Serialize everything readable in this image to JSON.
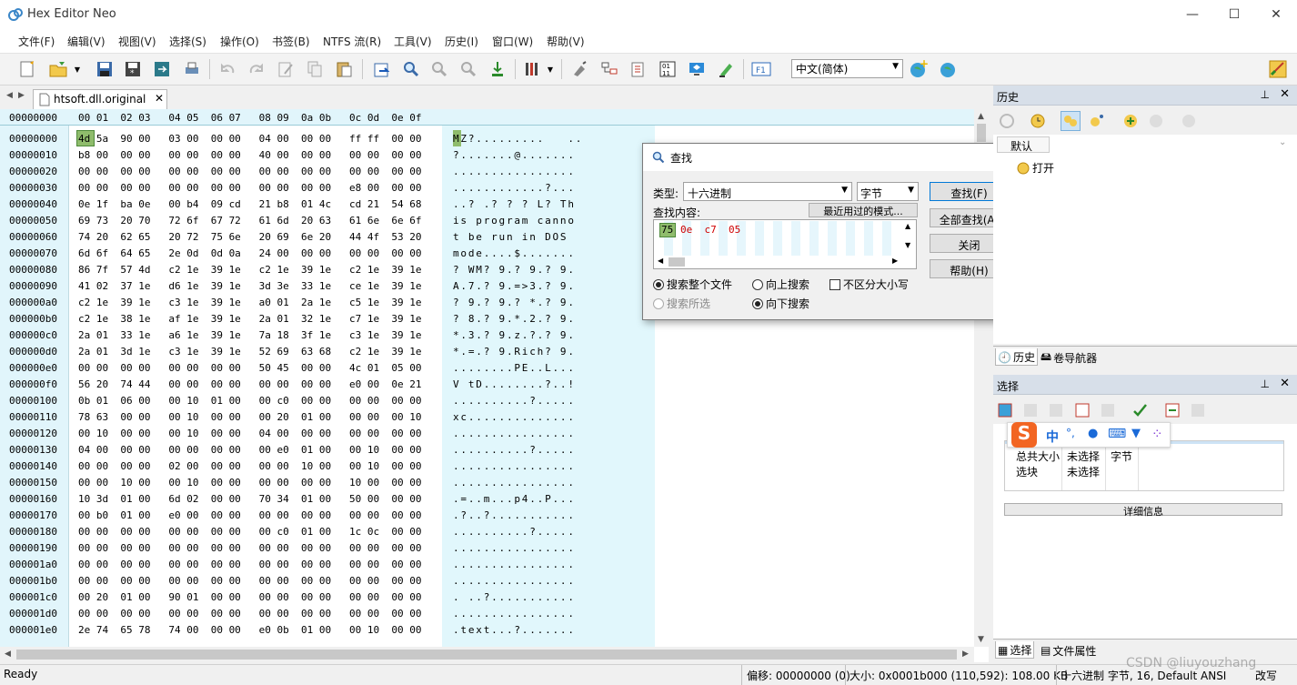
{
  "window": {
    "title": "Hex Editor Neo",
    "minimize": "—",
    "maximize": "☐",
    "close": "✕"
  },
  "menu": [
    "文件(F)",
    "编辑(V)",
    "视图(V)",
    "选择(S)",
    "操作(O)",
    "书签(B)",
    "NTFS 流(R)",
    "工具(V)",
    "历史(I)",
    "窗口(W)",
    "帮助(V)"
  ],
  "toolbar": {
    "language": "中文(简体)"
  },
  "tab": {
    "filename": "htsoft.dll.original",
    "close": "✕"
  },
  "hex_header": {
    "offset_label": "00000000",
    "columns": "00 01  02 03   04 05  06 07   08 09  0a 0b   0c 0d  0e 0f"
  },
  "hex_rows": [
    {
      "addr": "00000000",
      "bytes": "4d 5a  90 00   03 00  00 00   04 00  00 00   ff ff  00 00",
      "ascii": "MZ?.........   .."
    },
    {
      "addr": "00000010",
      "bytes": "b8 00  00 00   00 00  00 00   40 00  00 00   00 00  00 00",
      "ascii": "?.......@......."
    },
    {
      "addr": "00000020",
      "bytes": "00 00  00 00   00 00  00 00   00 00  00 00   00 00  00 00",
      "ascii": "................"
    },
    {
      "addr": "00000030",
      "bytes": "00 00  00 00   00 00  00 00   00 00  00 00   e8 00  00 00",
      "ascii": "............?..."
    },
    {
      "addr": "00000040",
      "bytes": "0e 1f  ba 0e   00 b4  09 cd   21 b8  01 4c   cd 21  54 68",
      "ascii": "..? .? ? ? L? Th"
    },
    {
      "addr": "00000050",
      "bytes": "69 73  20 70   72 6f  67 72   61 6d  20 63   61 6e  6e 6f",
      "ascii": "is program canno"
    },
    {
      "addr": "00000060",
      "bytes": "74 20  62 65   20 72  75 6e   20 69  6e 20   44 4f  53 20",
      "ascii": "t be run in DOS "
    },
    {
      "addr": "00000070",
      "bytes": "6d 6f  64 65   2e 0d  0d 0a   24 00  00 00   00 00  00 00",
      "ascii": "mode....$......."
    },
    {
      "addr": "00000080",
      "bytes": "86 7f  57 4d   c2 1e  39 1e   c2 1e  39 1e   c2 1e  39 1e",
      "ascii": "? WM? 9.? 9.? 9."
    },
    {
      "addr": "00000090",
      "bytes": "41 02  37 1e   d6 1e  39 1e   3d 3e  33 1e   ce 1e  39 1e",
      "ascii": "A.7.? 9.=>3.? 9."
    },
    {
      "addr": "000000a0",
      "bytes": "c2 1e  39 1e   c3 1e  39 1e   a0 01  2a 1e   c5 1e  39 1e",
      "ascii": "? 9.? 9.? *.? 9."
    },
    {
      "addr": "000000b0",
      "bytes": "c2 1e  38 1e   af 1e  39 1e   2a 01  32 1e   c7 1e  39 1e",
      "ascii": "? 8.? 9.*.2.? 9."
    },
    {
      "addr": "000000c0",
      "bytes": "2a 01  33 1e   a6 1e  39 1e   7a 18  3f 1e   c3 1e  39 1e",
      "ascii": "*.3.? 9.z.?.? 9."
    },
    {
      "addr": "000000d0",
      "bytes": "2a 01  3d 1e   c3 1e  39 1e   52 69  63 68   c2 1e  39 1e",
      "ascii": "*.=.? 9.Rich? 9."
    },
    {
      "addr": "000000e0",
      "bytes": "00 00  00 00   00 00  00 00   50 45  00 00   4c 01  05 00",
      "ascii": "........PE..L..."
    },
    {
      "addr": "000000f0",
      "bytes": "56 20  74 44   00 00  00 00   00 00  00 00   e0 00  0e 21",
      "ascii": "V tD........?..!"
    },
    {
      "addr": "00000100",
      "bytes": "0b 01  06 00   00 10  01 00   00 c0  00 00   00 00  00 00",
      "ascii": "..........?....."
    },
    {
      "addr": "00000110",
      "bytes": "78 63  00 00   00 10  00 00   00 20  01 00   00 00  00 10",
      "ascii": "xc.............."
    },
    {
      "addr": "00000120",
      "bytes": "00 10  00 00   00 10  00 00   04 00  00 00   00 00  00 00",
      "ascii": "................"
    },
    {
      "addr": "00000130",
      "bytes": "04 00  00 00   00 00  00 00   00 e0  01 00   00 10  00 00",
      "ascii": "..........?....."
    },
    {
      "addr": "00000140",
      "bytes": "00 00  00 00   02 00  00 00   00 00  10 00   00 10  00 00",
      "ascii": "................"
    },
    {
      "addr": "00000150",
      "bytes": "00 00  10 00   00 10  00 00   00 00  00 00   10 00  00 00",
      "ascii": "................"
    },
    {
      "addr": "00000160",
      "bytes": "10 3d  01 00   6d 02  00 00   70 34  01 00   50 00  00 00",
      "ascii": ".=..m...p4..P..."
    },
    {
      "addr": "00000170",
      "bytes": "00 b0  01 00   e0 00  00 00   00 00  00 00   00 00  00 00",
      "ascii": ".?..?..........."
    },
    {
      "addr": "00000180",
      "bytes": "00 00  00 00   00 00  00 00   00 c0  01 00   1c 0c  00 00",
      "ascii": "..........?....."
    },
    {
      "addr": "00000190",
      "bytes": "00 00  00 00   00 00  00 00   00 00  00 00   00 00  00 00",
      "ascii": "................"
    },
    {
      "addr": "000001a0",
      "bytes": "00 00  00 00   00 00  00 00   00 00  00 00   00 00  00 00",
      "ascii": "................"
    },
    {
      "addr": "000001b0",
      "bytes": "00 00  00 00   00 00  00 00   00 00  00 00   00 00  00 00",
      "ascii": "................"
    },
    {
      "addr": "000001c0",
      "bytes": "00 20  01 00   90 01  00 00   00 00  00 00   00 00  00 00",
      "ascii": ". ..?..........."
    },
    {
      "addr": "000001d0",
      "bytes": "00 00  00 00   00 00  00 00   00 00  00 00   00 00  00 00",
      "ascii": "................"
    },
    {
      "addr": "000001e0",
      "bytes": "2e 74  65 78   74 00  00 00   e0 0b  01 00   00 10  00 00",
      "ascii": ".text...?......."
    }
  ],
  "find_dialog": {
    "title": "查找",
    "close": "✕",
    "type_label": "类型:",
    "type_value": "十六进制",
    "unit_value": "字节",
    "content_label": "查找内容:",
    "recent_button": "最近用过的模式...",
    "pattern_first": "75",
    "pattern_rest": "0e  c7  05",
    "find_button": "查找(F)",
    "find_all_button": "全部查找(A)",
    "close_button": "关闭",
    "help_button": "帮助(H)",
    "radio_whole": "搜索整个文件",
    "radio_selection": "搜索所选",
    "radio_up": "向上搜索",
    "radio_down": "向下搜索",
    "checkbox_case": "不区分大小写"
  },
  "history_panel": {
    "title": "历史",
    "pin": "⊥",
    "close": "✕",
    "group": "默认",
    "item": "打开",
    "tab_history": "历史",
    "tab_navigator": "卷导航器"
  },
  "selection_panel": {
    "title": "选择",
    "pin": "⊥",
    "close": "✕",
    "rows": [
      [
        "总共大小",
        "未选择",
        "字节"
      ],
      [
        "选块",
        "未选择",
        ""
      ]
    ],
    "details_button": "详细信息",
    "tab_selection": "选择",
    "tab_props": "文件属性"
  },
  "ime": {
    "zh": "中",
    "punct": "°,",
    "mic": "🎤",
    "kbd": "⌨",
    "skin": "👕",
    "apps": "⁘"
  },
  "status": {
    "ready": "Ready",
    "offset": "偏移: 00000000 (0)",
    "size": "大小: 0x0001b000 (110,592): 108.00 KB",
    "mode": "十六进制 字节, 16, Default ANSI",
    "overwrite": "改写"
  },
  "watermark": "CSDN @liuyouzhang",
  "colors": {
    "hex_bg": "#e1f5fb",
    "panel_header": "#d7dfe9",
    "pattern_red": "#d00000",
    "selected_byte": "#8fbc6c"
  }
}
